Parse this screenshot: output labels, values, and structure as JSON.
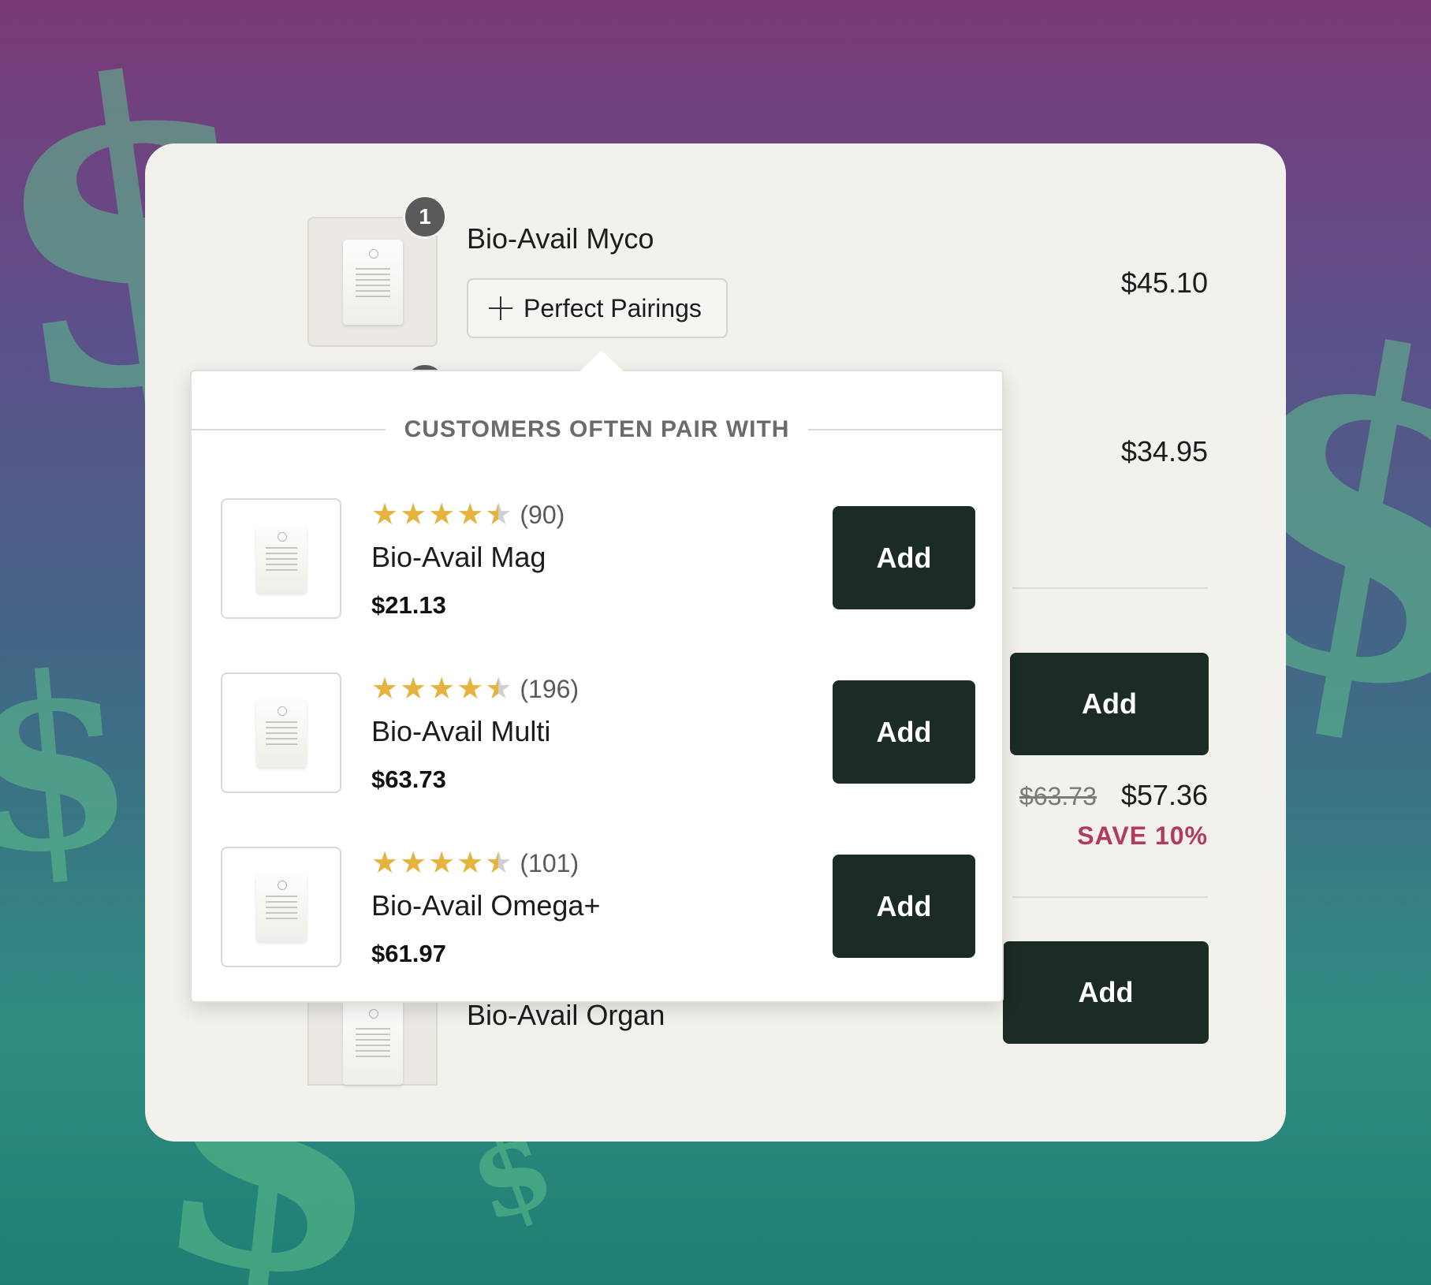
{
  "colors": {
    "card_bg": "#f3f1ec",
    "button_dark": "#1b2b25",
    "star_gold": "#e6b33e",
    "save_red": "#b23a5e",
    "background_top": "#7a3a78",
    "background_bottom": "#1f7f74"
  },
  "background": {
    "symbol": "$"
  },
  "cart": {
    "items": [
      {
        "quantity": "1",
        "title": "Bio-Avail Myco",
        "price": "$45.10",
        "pairings_button": {
          "icon": "plus-icon",
          "label": "Perfect Pairings"
        }
      },
      {
        "price": "$34.95"
      }
    ],
    "upsells": [
      {
        "add_label": "Add",
        "old_price": "$63.73",
        "price": "$57.36",
        "save_label": "SAVE 10%"
      },
      {
        "add_label": "Add",
        "title": "Bio-Avail Organ"
      }
    ]
  },
  "popover": {
    "header": "CUSTOMERS OFTEN PAIR WITH",
    "items": [
      {
        "rating": 4.5,
        "review_count": "(90)",
        "name": "Bio-Avail Mag",
        "price": "$21.13",
        "add_label": "Add"
      },
      {
        "rating": 4.5,
        "review_count": "(196)",
        "name": "Bio-Avail Multi",
        "price": "$63.73",
        "add_label": "Add"
      },
      {
        "rating": 4.5,
        "review_count": "(101)",
        "name": "Bio-Avail Omega+",
        "price": "$61.97",
        "add_label": "Add"
      }
    ]
  }
}
